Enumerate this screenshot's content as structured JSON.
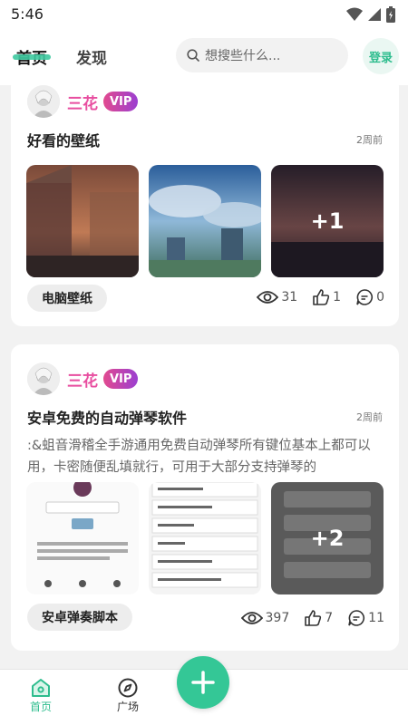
{
  "status_bar": {
    "time": "5:46"
  },
  "header": {
    "tabs": [
      {
        "label": "首页"
      },
      {
        "label": "发现"
      }
    ],
    "search": {
      "placeholder": "想搜些什么..."
    },
    "login_label": "登录"
  },
  "posts": [
    {
      "user": {
        "name": "三花",
        "badge": "VIP"
      },
      "title": "好看的壁纸",
      "time": "2周前",
      "more_images": "+1",
      "tag": "电脑壁纸",
      "views": "31",
      "likes": "1",
      "comments": "0"
    },
    {
      "user": {
        "name": "三花",
        "badge": "VIP"
      },
      "title": "安卓免费的自动弹琴软件",
      "time": "2周前",
      "description": ":&蛆音滑稽全手游通用免费自动弹琴所有键位基本上都可以用，卡密随便乱填就行，可用于大部分支持弹琴的",
      "more_images": "+2",
      "tag": "安卓弹奏脚本",
      "views": "397",
      "likes": "7",
      "comments": "11"
    }
  ],
  "bottom_nav": {
    "items": [
      {
        "label": "首页"
      },
      {
        "label": "广场"
      }
    ]
  },
  "colors": {
    "accent": "#34c796",
    "vip_start": "#e24a8f",
    "vip_end": "#9b3fd1",
    "username": "#e84ea0"
  }
}
